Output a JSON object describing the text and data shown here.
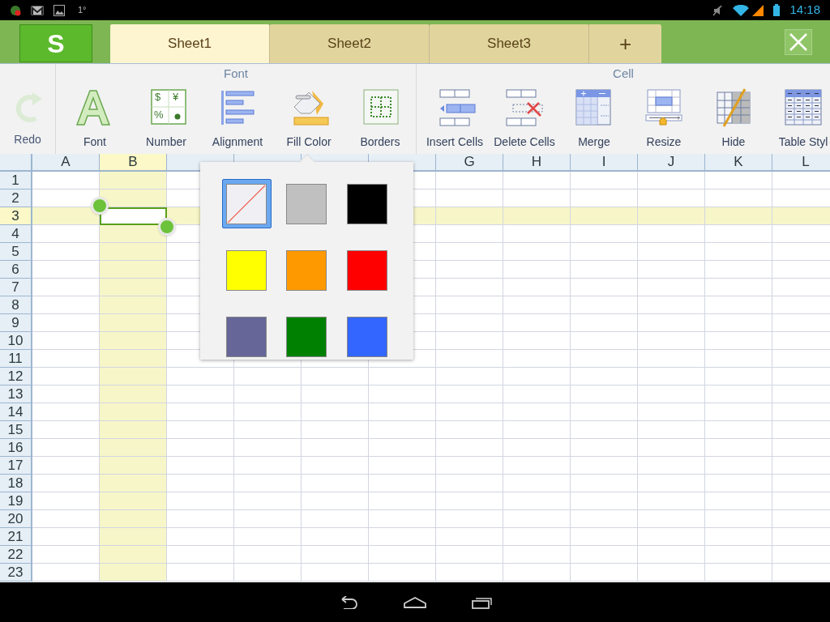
{
  "status_bar": {
    "temperature": "1°",
    "time": "14:18"
  },
  "app_bar": {
    "logo": "S",
    "tabs": [
      {
        "label": "Sheet1",
        "selected": true
      },
      {
        "label": "Sheet2",
        "selected": false
      },
      {
        "label": "Sheet3",
        "selected": false
      }
    ],
    "add_tab": "+"
  },
  "toolbar": {
    "redo": {
      "label": "Redo",
      "disabled": true
    },
    "groups": [
      {
        "title": "Font",
        "items": [
          {
            "label": "Font"
          },
          {
            "label": "Number",
            "icon_symbols": [
              "$",
              "¥",
              "%"
            ]
          },
          {
            "label": "Alignment"
          },
          {
            "label": "Fill Color"
          },
          {
            "label": "Borders"
          }
        ]
      },
      {
        "title": "Cell",
        "items": [
          {
            "label": "Insert Cells"
          },
          {
            "label": "Delete Cells"
          },
          {
            "label": "Merge"
          },
          {
            "label": "Resize"
          },
          {
            "label": "Hide"
          },
          {
            "label": "Table Styl"
          }
        ]
      }
    ]
  },
  "sheet": {
    "columns": [
      {
        "label": "A",
        "selected": false
      },
      {
        "label": "B",
        "selected": true
      },
      {
        "selected": false
      },
      {
        "selected": false
      },
      {
        "selected": false
      },
      {
        "selected": false
      },
      {
        "label": "G",
        "selected": false
      },
      {
        "label": "H",
        "selected": false
      },
      {
        "label": "I",
        "selected": false
      },
      {
        "label": "J",
        "selected": false
      },
      {
        "label": "K",
        "selected": false
      },
      {
        "label": "L",
        "selected": false
      }
    ],
    "rows": [
      {
        "label": "1",
        "selected": false
      },
      {
        "label": "2",
        "selected": false
      },
      {
        "label": "3",
        "selected": true
      },
      {
        "label": "4",
        "selected": false
      },
      {
        "label": "5",
        "selected": false
      },
      {
        "label": "6",
        "selected": false
      },
      {
        "label": "7",
        "selected": false
      },
      {
        "label": "8",
        "selected": false
      },
      {
        "label": "9",
        "selected": false
      },
      {
        "label": "10",
        "selected": false
      },
      {
        "label": "11",
        "selected": false
      },
      {
        "label": "12",
        "selected": false
      },
      {
        "label": "13",
        "selected": false
      },
      {
        "label": "14",
        "selected": false
      },
      {
        "label": "15",
        "selected": false
      },
      {
        "label": "16",
        "selected": false
      },
      {
        "label": "17",
        "selected": false
      },
      {
        "label": "18",
        "selected": false
      },
      {
        "label": "19",
        "selected": false
      },
      {
        "label": "20",
        "selected": false
      },
      {
        "label": "21",
        "selected": false
      },
      {
        "label": "22",
        "selected": false
      },
      {
        "label": "23",
        "selected": false
      }
    ]
  },
  "fill_color_popup": {
    "swatches": [
      {
        "kind": "none",
        "selected": true
      },
      {
        "kind": "color",
        "color": "#c0c0c0",
        "selected": false
      },
      {
        "kind": "color",
        "color": "#000000",
        "selected": false
      },
      {
        "kind": "color",
        "color": "#ffff00",
        "selected": false
      },
      {
        "kind": "color",
        "color": "#ff9900",
        "selected": false
      },
      {
        "kind": "color",
        "color": "#ff0000",
        "selected": false
      },
      {
        "kind": "color",
        "color": "#666699",
        "selected": false
      },
      {
        "kind": "color",
        "color": "#008000",
        "selected": false
      },
      {
        "kind": "color",
        "color": "#3366ff",
        "selected": false
      }
    ]
  }
}
